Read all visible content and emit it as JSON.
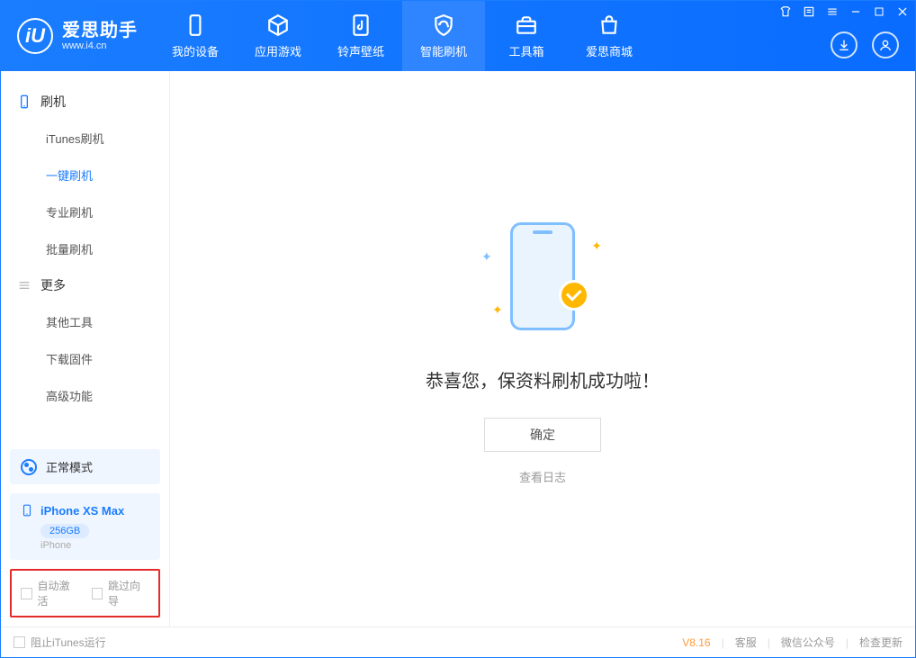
{
  "logo": {
    "title": "爱思助手",
    "subtitle": "www.i4.cn",
    "mark": "iU"
  },
  "headerTabs": [
    {
      "label": "我的设备"
    },
    {
      "label": "应用游戏"
    },
    {
      "label": "铃声壁纸"
    },
    {
      "label": "智能刷机"
    },
    {
      "label": "工具箱"
    },
    {
      "label": "爱思商城"
    }
  ],
  "sidebar": {
    "section1": "刷机",
    "items1": [
      {
        "label": "iTunes刷机"
      },
      {
        "label": "一键刷机"
      },
      {
        "label": "专业刷机"
      },
      {
        "label": "批量刷机"
      }
    ],
    "section2": "更多",
    "items2": [
      {
        "label": "其他工具"
      },
      {
        "label": "下载固件"
      },
      {
        "label": "高级功能"
      }
    ],
    "mode": "正常模式",
    "device": {
      "name": "iPhone XS Max",
      "capacity": "256GB",
      "type": "iPhone"
    },
    "checks": {
      "autoActivate": "自动激活",
      "skipGuide": "跳过向导"
    }
  },
  "main": {
    "successMsg": "恭喜您，保资料刷机成功啦！",
    "okBtn": "确定",
    "logLink": "查看日志"
  },
  "footer": {
    "blockItunes": "阻止iTunes运行",
    "version": "V8.16",
    "links": {
      "service": "客服",
      "wechat": "微信公众号",
      "update": "检查更新"
    }
  }
}
